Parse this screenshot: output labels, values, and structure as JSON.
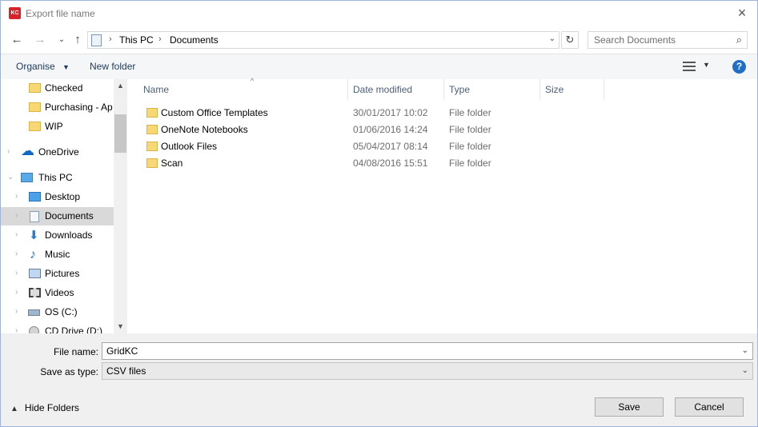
{
  "window": {
    "app_icon_text": "KC",
    "title": "Export file name",
    "close_icon": "close-x",
    "colors": {
      "selected": "#d9d9d9",
      "header_text": "#4c607a",
      "link_text": "#1e395b",
      "folder": "#f8d775"
    }
  },
  "nav": {
    "back_icon": "arrow-left",
    "forward_icon": "arrow-right",
    "recent_icon": "chevron-down",
    "up_icon": "arrow-up",
    "breadcrumb": [
      "This PC",
      "Documents"
    ],
    "refresh_icon": "refresh",
    "search_placeholder": "Search Documents",
    "search_icon": "magnifier"
  },
  "toolbar": {
    "organise": "Organise",
    "new_folder": "New folder",
    "view_icon": "details-view",
    "help": "?"
  },
  "sidebar": {
    "items": [
      {
        "label": "Checked",
        "icon": "folder-icon"
      },
      {
        "label": "Purchasing - Ap",
        "icon": "folder-icon"
      },
      {
        "label": "WIP",
        "icon": "folder-icon"
      },
      {
        "label": "OneDrive",
        "icon": "cloud-icon"
      },
      {
        "label": "This PC",
        "icon": "computer-icon"
      },
      {
        "label": "Desktop",
        "icon": "desktop-icon"
      },
      {
        "label": "Documents",
        "icon": "documents-icon"
      },
      {
        "label": "Downloads",
        "icon": "download-arrow-icon"
      },
      {
        "label": "Music",
        "icon": "music-note-icon"
      },
      {
        "label": "Pictures",
        "icon": "pictures-icon"
      },
      {
        "label": "Videos",
        "icon": "video-film-icon"
      },
      {
        "label": "OS (C:)",
        "icon": "drive-icon"
      },
      {
        "label": "CD Drive (D:)",
        "icon": "cd-drive-icon"
      }
    ]
  },
  "files": {
    "columns": [
      "Name",
      "Date modified",
      "Type",
      "Size"
    ],
    "rows": [
      {
        "name": "Custom Office Templates",
        "date": "30/01/2017 10:02",
        "type": "File folder",
        "size": ""
      },
      {
        "name": "OneNote Notebooks",
        "date": "01/06/2016 14:24",
        "type": "File folder",
        "size": ""
      },
      {
        "name": "Outlook Files",
        "date": "05/04/2017 08:14",
        "type": "File folder",
        "size": ""
      },
      {
        "name": "Scan",
        "date": "04/08/2016 15:51",
        "type": "File folder",
        "size": ""
      }
    ]
  },
  "form": {
    "file_name_label": "File name:",
    "file_name_value": "GridKC",
    "save_as_label": "Save as type:",
    "save_as_value": "CSV files"
  },
  "footer": {
    "hide_folders": "Hide Folders",
    "save": "Save",
    "cancel": "Cancel"
  }
}
